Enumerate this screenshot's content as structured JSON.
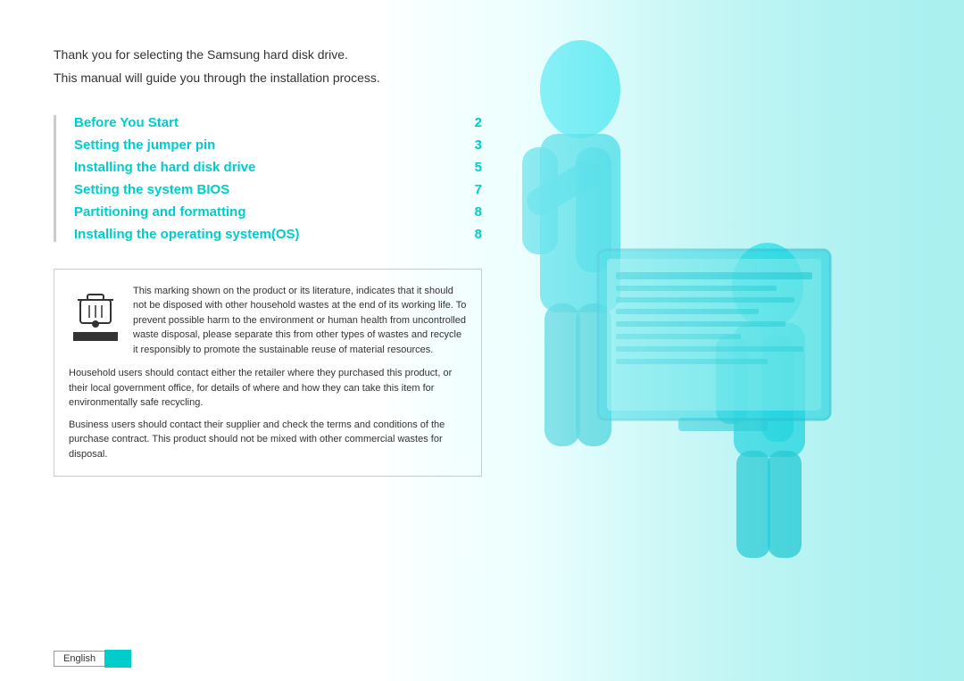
{
  "intro": {
    "line1": "Thank you for selecting the Samsung hard disk drive.",
    "line2": "This manual will guide you through the installation process."
  },
  "toc": {
    "items": [
      {
        "label": "Before You Start",
        "page": "2"
      },
      {
        "label": "Setting the jumper pin",
        "page": "3"
      },
      {
        "label": "Installing the hard disk drive",
        "page": "5"
      },
      {
        "label": "Setting the system BIOS",
        "page": "7"
      },
      {
        "label": "Partitioning and formatting",
        "page": "8"
      },
      {
        "label": "Installing the operating system(OS)",
        "page": "8"
      }
    ]
  },
  "infobox": {
    "main_text": "This marking shown on the product or its literature, indicates that it should not be disposed with other household wastes at the end of its working life. To prevent possible harm to the environment or human health from uncontrolled waste disposal, please separate this from other types of wastes and recycle it responsibly to promote the sustainable reuse of material resources.",
    "paragraph2": "Household users should contact either the retailer where they purchased this product, or their local government office, for details of where and how they can take this item for environmentally safe recycling.",
    "paragraph3": "Business users should contact their supplier and check the terms and conditions of the purchase contract.  This product should not be mixed with other commercial wastes for disposal."
  },
  "footer": {
    "language": "English"
  }
}
